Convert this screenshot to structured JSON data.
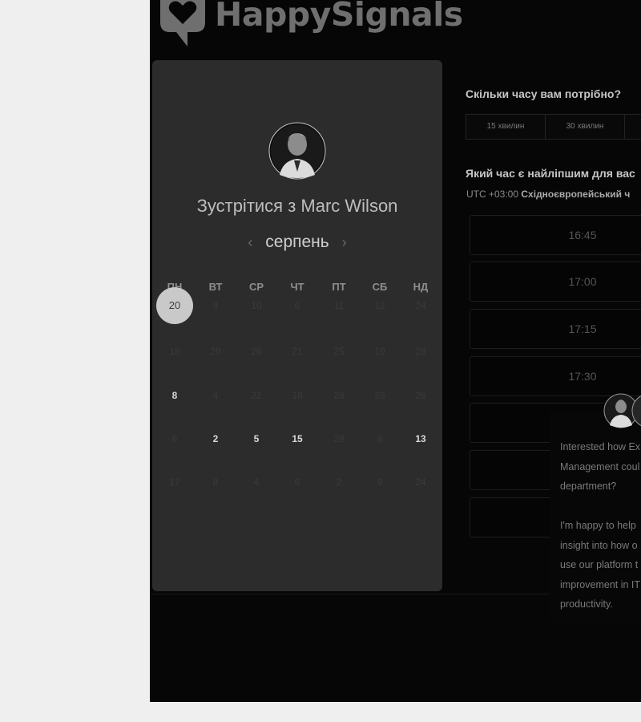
{
  "brand": {
    "name": "HappySignals",
    "logo_icon": "heart-chat-logo-icon"
  },
  "calendar": {
    "title": "Зустрітися з Marc Wilson",
    "month": "серпень",
    "prev_icon": "chevron-left-icon",
    "next_icon": "chevron-right-icon",
    "weekdays": [
      "ПН",
      "ВТ",
      "СР",
      "ЧТ",
      "ПТ",
      "СБ",
      "НД"
    ],
    "selected_day": "20",
    "weeks": [
      [
        {
          "d": "20",
          "s": "selected"
        },
        {
          "d": "8",
          "s": "muted"
        },
        {
          "d": "10",
          "s": "muted"
        },
        {
          "d": "6",
          "s": "muted"
        },
        {
          "d": "11",
          "s": "muted"
        },
        {
          "d": "12",
          "s": "muted"
        },
        {
          "d": "24",
          "s": "muted"
        }
      ],
      [
        {
          "d": "18",
          "s": "muted"
        },
        {
          "d": "20",
          "s": "muted"
        },
        {
          "d": "26",
          "s": "muted"
        },
        {
          "d": "21",
          "s": "muted"
        },
        {
          "d": "25",
          "s": "muted"
        },
        {
          "d": "10",
          "s": "muted"
        },
        {
          "d": "28",
          "s": "muted"
        }
      ],
      [
        {
          "d": "8",
          "s": "avail"
        },
        {
          "d": "4",
          "s": "muted"
        },
        {
          "d": "22",
          "s": "muted"
        },
        {
          "d": "18",
          "s": "muted"
        },
        {
          "d": "28",
          "s": "muted"
        },
        {
          "d": "28",
          "s": "muted"
        },
        {
          "d": "26",
          "s": "muted"
        }
      ],
      [
        {
          "d": "6",
          "s": "muted"
        },
        {
          "d": "2",
          "s": "avail"
        },
        {
          "d": "5",
          "s": "avail"
        },
        {
          "d": "15",
          "s": "avail"
        },
        {
          "d": "28",
          "s": "muted"
        },
        {
          "d": "8",
          "s": "muted"
        },
        {
          "d": "13",
          "s": "avail"
        }
      ],
      [
        {
          "d": "17",
          "s": "muted"
        },
        {
          "d": "8",
          "s": "muted"
        },
        {
          "d": "4",
          "s": "muted"
        },
        {
          "d": "6",
          "s": "muted"
        },
        {
          "d": "2",
          "s": "muted"
        },
        {
          "d": "9",
          "s": "muted"
        },
        {
          "d": "24",
          "s": "muted"
        }
      ]
    ]
  },
  "booking": {
    "duration_question": "Скільки часу вам потрібно?",
    "durations": [
      "15 хвилин",
      "30 хвилин",
      ""
    ],
    "time_question": "Який час є найліпшим для вас",
    "timezone_offset": "UTC +03:00",
    "timezone_name": "Східноєвропейський ч",
    "slots": [
      "16:45",
      "17:00",
      "17:15",
      "17:30",
      "",
      "",
      ""
    ]
  },
  "chat": {
    "lines": [
      "Interested how Ex",
      "Management coul",
      "department?",
      "",
      "I'm happy to help",
      "insight into how o",
      "use our platform t",
      "improvement in IT",
      "productivity."
    ]
  },
  "colors": {
    "page_bg": "#efefef",
    "panel_bg": "#2c2c2c",
    "frame_bg": "#060606",
    "selected_day": "#c9c9c9"
  }
}
